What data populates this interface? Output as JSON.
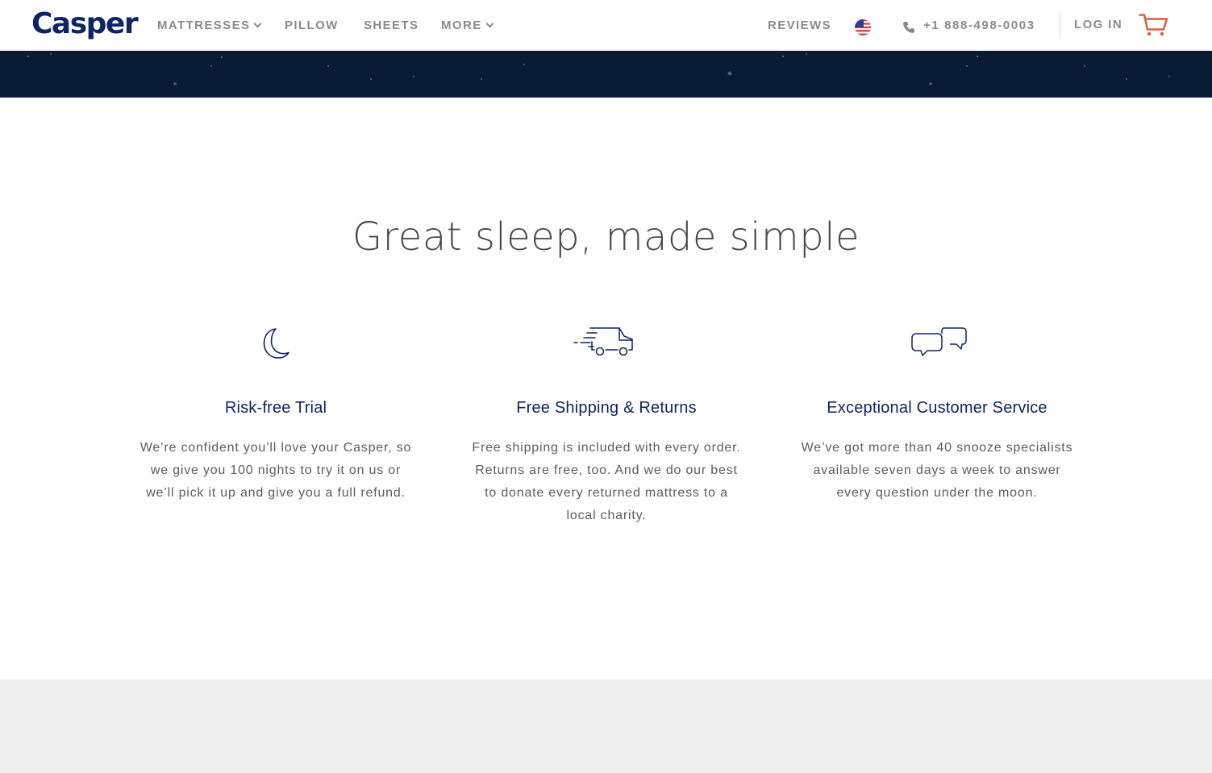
{
  "header": {
    "logo": "Casper",
    "nav": {
      "mattresses": "MATTRESSES",
      "pillow": "PILLOW",
      "sheets": "SHEETS",
      "more": "MORE"
    },
    "reviews": "REVIEWS",
    "phone": "+1 888-498-0003",
    "login": "LOG IN"
  },
  "main": {
    "headline": "Great sleep, made simple",
    "features": [
      {
        "title": "Risk-free Trial",
        "body": "We’re confident you’ll love your Casper, so we give you 100 nights to try it on us or we’ll pick it up and give you a full refund."
      },
      {
        "title": "Free Shipping & Returns",
        "body": "Free shipping is included with every order. Returns are free, too. And we do our best to donate every returned mattress to a local charity."
      },
      {
        "title": "Exceptional Customer Service",
        "body": "We’ve got more than 40 snooze specialists available seven days a week to answer every question under the moon."
      }
    ]
  },
  "colors": {
    "brand_navy": "#0d2567",
    "banner": "#081a34",
    "nav_gray": "#8a8a8a",
    "cart_accent": "#e35a3d",
    "footer_band": "#efefef"
  },
  "icons": {
    "feature_1": "moon-icon",
    "feature_2": "delivery-truck-icon",
    "feature_3": "chat-bubbles-icon",
    "cart": "shopping-cart-icon",
    "phone": "phone-icon",
    "flag": "us-flag-icon"
  }
}
